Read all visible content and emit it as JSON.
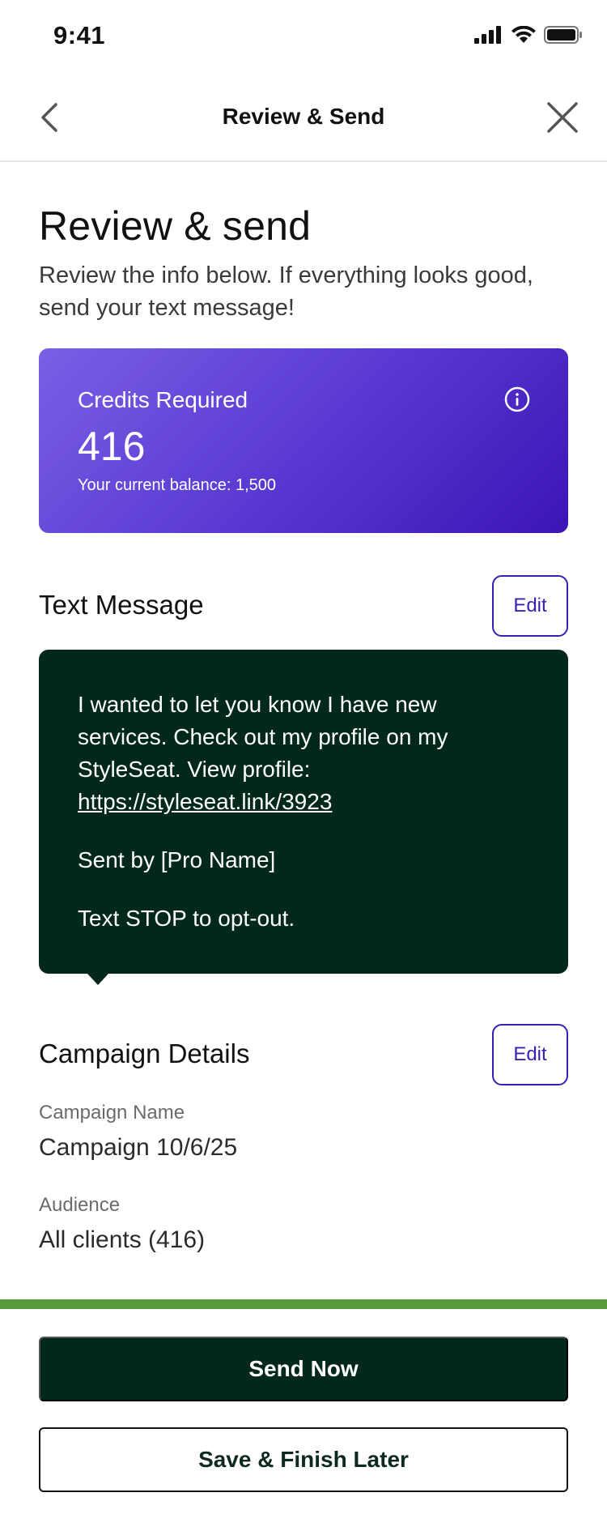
{
  "status_bar": {
    "time": "9:41"
  },
  "nav": {
    "title": "Review & Send"
  },
  "header": {
    "title": "Review & send",
    "subtitle": "Review the info below. If everything looks good, send your text message!"
  },
  "credits": {
    "label": "Credits Required",
    "value": "416",
    "balance": "Your current balance: 1,500"
  },
  "text_message": {
    "section_title": "Text Message",
    "edit_label": "Edit",
    "body_text": "I wanted to let you know I have new services. Check out my profile on my StyleSeat.  View profile: ",
    "link": "https://styleseat.link/3923",
    "sent_by": "Sent by [Pro Name]",
    "opt_out": "Text STOP to opt-out."
  },
  "campaign_details": {
    "section_title": "Campaign Details",
    "edit_label": "Edit",
    "name_label": "Campaign Name",
    "name_value": "Campaign 10/6/25",
    "audience_label": "Audience",
    "audience_value": "All clients (416)"
  },
  "actions": {
    "send_now": "Send Now",
    "save_later": "Save & Finish Later"
  },
  "colors": {
    "accent_purple": "#3a1fb5",
    "card_dark_green": "#00291a",
    "divider_green": "#5a9a3b"
  }
}
